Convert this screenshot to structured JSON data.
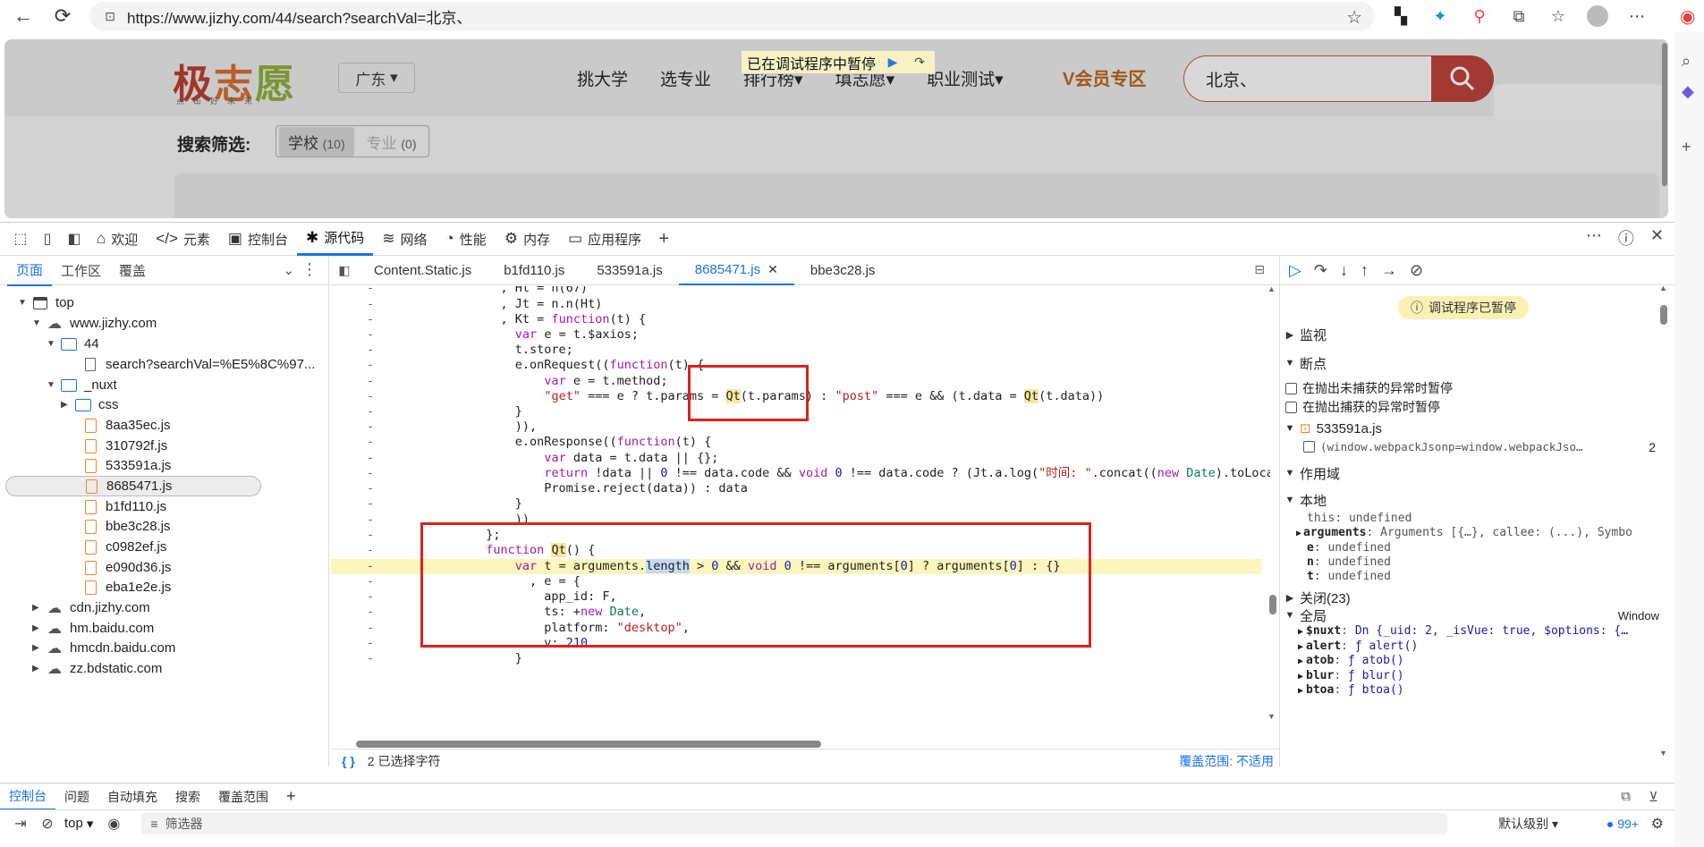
{
  "browser": {
    "url": "https://www.jizhy.com/44/search?searchVal=北京、",
    "back": "←",
    "reload": "⟳"
  },
  "page": {
    "logo_chars": [
      "极",
      "志",
      "愿"
    ],
    "logo_sub": "点击好未来",
    "province": "广东",
    "nav": [
      "挑大学",
      "选专业",
      "排行榜",
      "填志愿",
      "职业测试"
    ],
    "vip": "会员专区",
    "search_value": "北京、",
    "paused_banner": "已在调试程序中暂停",
    "filter_label": "搜索筛选:",
    "chip_school": "学校",
    "chip_school_count": "(10)",
    "chip_major": "专业",
    "chip_major_count": "(0)"
  },
  "devtools": {
    "tabs": [
      {
        "icon": "⌂",
        "label": "欢迎"
      },
      {
        "icon": "</>",
        "label": "元素"
      },
      {
        "icon": "▣",
        "label": "控制台"
      },
      {
        "icon": "✱",
        "label": "源代码"
      },
      {
        "icon": "≋",
        "label": "网络"
      },
      {
        "icon": "◔",
        "label": "性能"
      },
      {
        "icon": "⚙",
        "label": "内存"
      },
      {
        "icon": "▭",
        "label": "应用程序"
      }
    ],
    "navigator": {
      "tabs": [
        "页面",
        "工作区",
        "覆盖"
      ],
      "tree": [
        {
          "label": "top",
          "kind": "frame",
          "arrow": "▼"
        },
        {
          "label": "www.jizhy.com",
          "kind": "cloud",
          "arrow": "▼"
        },
        {
          "label": "44",
          "kind": "folder",
          "arrow": "▼"
        },
        {
          "label": "search?searchVal=%E5%8C%97...",
          "kind": "page",
          "arrow": ""
        },
        {
          "label": "_nuxt",
          "kind": "folder",
          "arrow": "▼"
        },
        {
          "label": "css",
          "kind": "folder",
          "arrow": "▶"
        },
        {
          "label": "8aa35ec.js",
          "kind": "file",
          "arrow": ""
        },
        {
          "label": "310792f.js",
          "kind": "file",
          "arrow": ""
        },
        {
          "label": "533591a.js",
          "kind": "file",
          "arrow": ""
        },
        {
          "label": "8685471.js",
          "kind": "file",
          "arrow": ""
        },
        {
          "label": "b1fd110.js",
          "kind": "file",
          "arrow": ""
        },
        {
          "label": "bbe3c28.js",
          "kind": "file",
          "arrow": ""
        },
        {
          "label": "c0982ef.js",
          "kind": "file",
          "arrow": ""
        },
        {
          "label": "e090d36.js",
          "kind": "file",
          "arrow": ""
        },
        {
          "label": "eba1e2e.js",
          "kind": "file",
          "arrow": ""
        },
        {
          "label": "cdn.jizhy.com",
          "kind": "cloud",
          "arrow": "▶"
        },
        {
          "label": "hm.baidu.com",
          "kind": "cloud",
          "arrow": "▶"
        },
        {
          "label": "hmcdn.baidu.com",
          "kind": "cloud",
          "arrow": "▶"
        },
        {
          "label": "zz.bdstatic.com",
          "kind": "cloud",
          "arrow": "▶"
        }
      ]
    },
    "editor": {
      "tabs": [
        "Content.Static.js",
        "b1fd110.js",
        "533591a.js",
        "8685471.js",
        "bbe3c28.js"
      ],
      "selection_status": "2 已选择字符",
      "coverage": "覆盖范围: 不适用"
    },
    "debugger": {
      "paused": "调试程序已暂停",
      "watch": "监视",
      "breakpoints": "断点",
      "pause_uncaught": "在抛出未捕获的异常时暂停",
      "pause_caught": "在抛出捕获的异常时暂停",
      "bp_file": "533591a.js",
      "bp_code": "(window.webpackJsonp=window.webpackJso…",
      "bp_line": "2",
      "scope": "作用域",
      "local": "本地",
      "closure": "关闭(23)",
      "global": "全局",
      "global_value": "Window",
      "local_vars": [
        {
          "k": "this",
          "v": "undefined"
        },
        {
          "k": "arguments",
          "v": "Arguments [{…}, callee: (...), Symbo"
        },
        {
          "k": "e",
          "v": "undefined"
        },
        {
          "k": "n",
          "v": "undefined"
        },
        {
          "k": "t",
          "v": "undefined"
        }
      ],
      "global_vars": [
        {
          "k": "$nuxt",
          "v": "Dn {_uid: 2, _isVue: true, $options: {…"
        },
        {
          "k": "alert",
          "v": "ƒ alert()"
        },
        {
          "k": "atob",
          "v": "ƒ atob()"
        },
        {
          "k": "blur",
          "v": "ƒ blur()"
        },
        {
          "k": "btoa",
          "v": "ƒ btoa()"
        }
      ]
    },
    "drawer": {
      "tabs": [
        "控制台",
        "问题",
        "自动填充",
        "搜索",
        "覆盖范围"
      ],
      "context": "top",
      "filter": "筛选器",
      "level": "默认级别",
      "issues": "99+"
    }
  }
}
